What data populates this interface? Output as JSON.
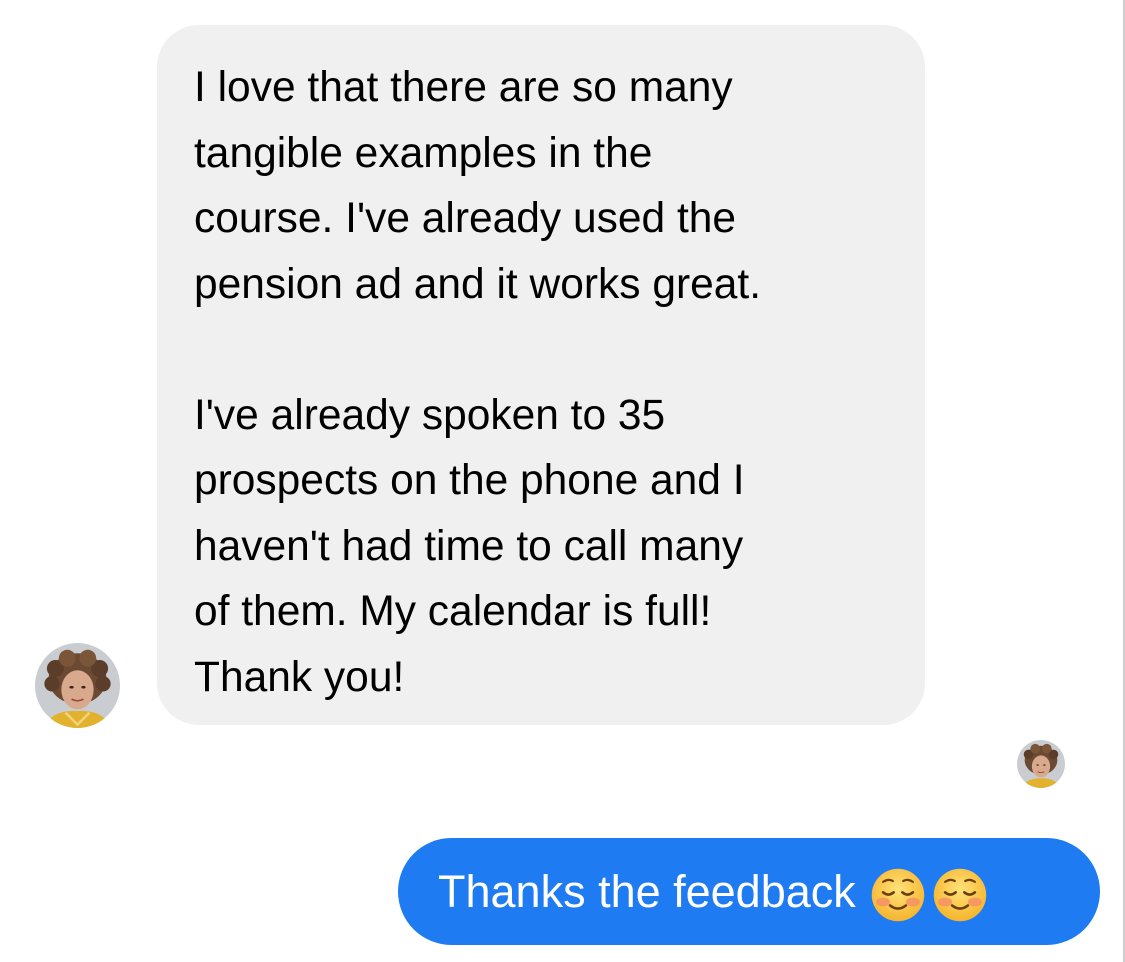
{
  "conversation": {
    "incoming_message": {
      "paragraph_1": "I love that there are so many\ntangible examples in the\ncourse. I've already used the\npension ad and it works great.",
      "paragraph_2": "I've already spoken to 35\nprospects on the phone and I\nhaven't had time to call many\nof them. My calendar is full!\nThank you!"
    },
    "outgoing_message": {
      "text": "Thanks the feedback",
      "emojis": [
        "smiling-blushing-face-icon",
        "smiling-blushing-face-icon"
      ]
    }
  },
  "colors": {
    "incoming_bubble": "#f0f0f0",
    "outgoing_bubble": "#1f7bf2",
    "incoming_text": "#000000",
    "outgoing_text": "#ffffff"
  }
}
